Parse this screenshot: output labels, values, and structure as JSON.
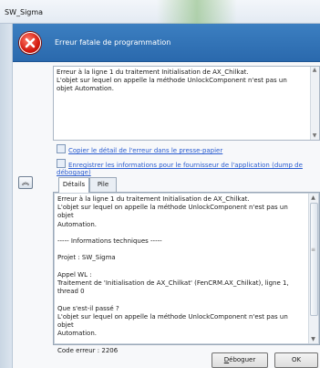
{
  "window": {
    "title": "SW_Sigma"
  },
  "header": {
    "title": "Erreur fatale de programmation"
  },
  "message": {
    "text": "Erreur à la ligne 1 du traitement Initialisation de AX_Chilkat.\nL'objet sur lequel on appelle la méthode UnlockComponent n'est pas un objet Automation."
  },
  "links": {
    "copy": "Copier le détail de l'erreur dans le presse-papier",
    "save": "Enregistrer les informations pour le fournisseur de l'application (dump de débogage)"
  },
  "tabs": [
    {
      "label": "Détails"
    },
    {
      "label": "Pile"
    }
  ],
  "details": {
    "text": "Erreur à la ligne 1 du traitement Initialisation de AX_Chilkat.\nL'objet sur lequel on appelle la méthode UnlockComponent n'est pas un objet\nAutomation.\n\n----- Informations techniques -----\n\nProjet : SW_Sigma\n\nAppel WL :\nTraitement de 'Initialisation de AX_Chilkat' (FenCRM.AX_Chilkat), ligne 1, thread 0\n\nQue s'est-il passé ?\nL'objet sur lequel on appelle la méthode UnlockComponent n'est pas un objet\nAutomation.\n\nCode erreur : 2206"
  },
  "buttons": {
    "debug_prefix": "D",
    "debug_rest": "éboguer",
    "ok": "OK"
  },
  "icons": {
    "error": "error-icon",
    "copy": "clipboard-icon",
    "save": "floppy-disk-icon",
    "collapse": "double-chevron-up-icon"
  },
  "colors": {
    "banner": "#2f72b6",
    "link": "#2a5cd0",
    "error_red": "#d41b10"
  }
}
